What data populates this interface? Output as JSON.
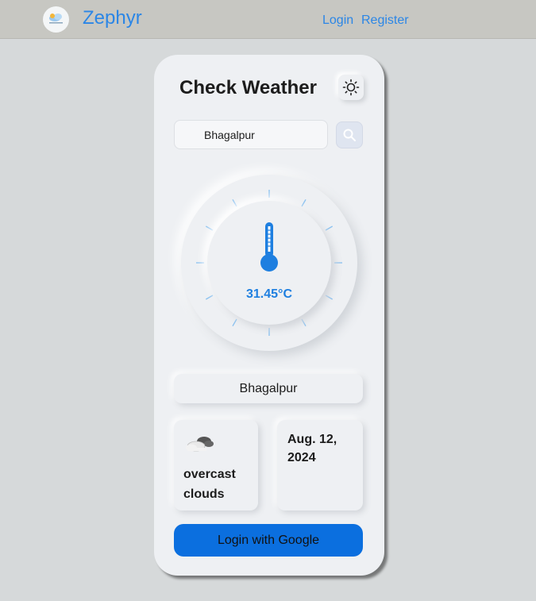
{
  "nav": {
    "brand": "Zephyr",
    "login_label": "Login",
    "register_label": "Register",
    "logo_icon": "cloud-logo-icon"
  },
  "card": {
    "title": "Check Weather",
    "theme_icon": "sun-icon",
    "search": {
      "value": "Bhagalpur",
      "icon": "search-icon"
    },
    "temperature": "31.45°C",
    "thermometer_icon": "thermometer-icon",
    "city": "Bhagalpur",
    "weather_icon": "cloud-icon",
    "description_line1": "overcast",
    "description_line2": "clouds",
    "date_line1": "Aug. 12,",
    "date_line2": "2024",
    "google_button": "Login with Google"
  },
  "colors": {
    "accent": "#2b86e6",
    "temperature": "#1e7fe0",
    "google_button": "#0b6fdf",
    "card": "#eef0f3",
    "navbar": "#c7c7c2",
    "background": "#d6d9da"
  }
}
